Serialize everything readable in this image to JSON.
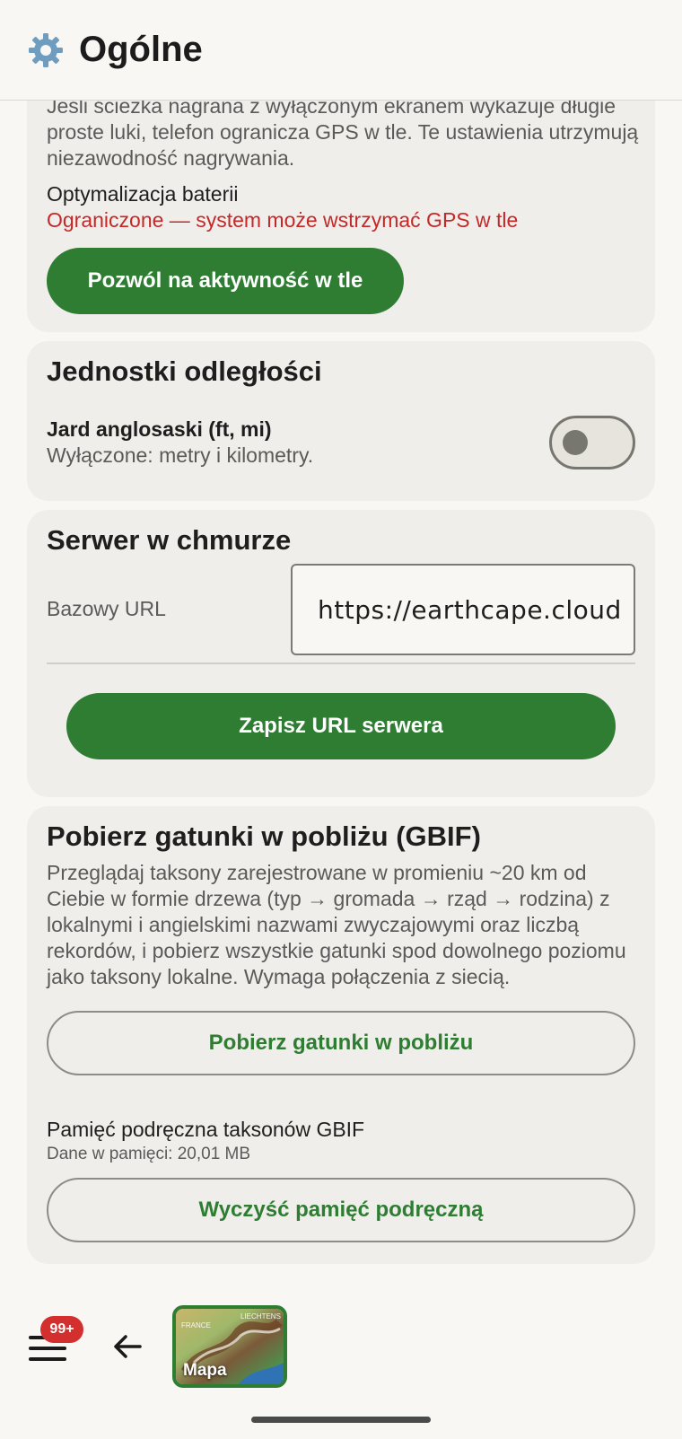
{
  "header": {
    "title": "Ogólne",
    "icon": "gear-icon"
  },
  "background_card": {
    "intro_text": "Jeśli ścieżka nagrana z wyłączonym ekranem wykazuje długie proste luki, telefon ogranicza GPS w tle. Te ustawienia utrzymują niezawodność nagrywania.",
    "battery_label": "Optymalizacja baterii",
    "battery_status": "Ograniczone — system może wstrzymać GPS w tle",
    "battery_status_color": "#c62828",
    "allow_button": "Pozwól na aktywność w tle"
  },
  "units_card": {
    "title": "Jednostki odległości",
    "option_title": "Jard anglosaski (ft, mi)",
    "option_subtitle": "Wyłączone: metry i kilometry.",
    "toggle_on": false
  },
  "cloud_card": {
    "title": "Serwer w chmurze",
    "url_label": "Bazowy URL",
    "url_value": "https://earthcape.cloud",
    "save_button": "Zapisz URL serwera"
  },
  "gbif_card": {
    "title": "Pobierz gatunki w pobliżu (GBIF)",
    "description": "Przeglądaj taksony zarejestrowane w promieniu ~20 km od Ciebie w formie drzewa (typ → gromada → rząd → rodzina) z lokalnymi i angielskimi nazwami zwyczajowymi oraz liczbą rekordów, i pobierz wszystkie gatunki spod dowolnego poziomu jako taksony lokalne. Wymaga połączenia z siecią.",
    "fetch_button": "Pobierz gatunki w pobliżu",
    "cache_title": "Pamięć podręczna taksonów GBIF",
    "cache_size": "Dane w pamięci: 20,01 MB",
    "clear_button": "Wyczyść pamięć podręczną"
  },
  "bottom_bar": {
    "badge": "99+",
    "map_label": "Mapa",
    "map_tiny_left": "FRANCE",
    "map_tiny_right": "LIECHTENS"
  },
  "colors": {
    "accent": "#2e7d32",
    "background": "#f8f7f3",
    "card": "#efeeea",
    "badge": "#d32f2f"
  }
}
